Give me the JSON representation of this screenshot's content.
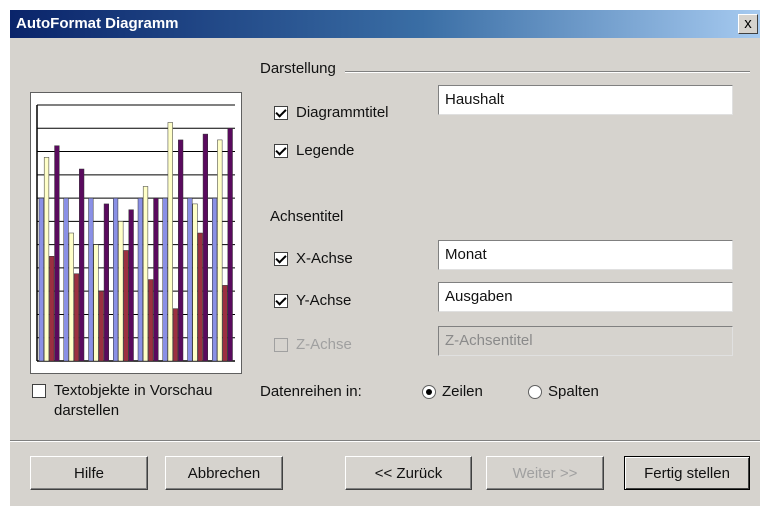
{
  "window": {
    "title": "AutoFormat Diagramm",
    "close_label": "x"
  },
  "darstellung": {
    "label": "Darstellung",
    "diagrammtitel": {
      "label": "Diagrammtitel",
      "checked": true,
      "value": "Haushalt"
    },
    "legende": {
      "label": "Legende",
      "checked": true
    }
  },
  "achsentitel": {
    "label": "Achsentitel",
    "x_achse": {
      "label": "X-Achse",
      "checked": true,
      "value": "Monat"
    },
    "y_achse": {
      "label": "Y-Achse",
      "checked": true,
      "value": "Ausgaben"
    },
    "z_achse": {
      "label": "Z-Achse",
      "checked": false,
      "enabled": false,
      "value": "Z-Achsentitel"
    }
  },
  "preview": {
    "textobjekte_label_line1": "Textobjekte in Vorschau",
    "textobjekte_label_line2": "darstellen",
    "textobjekte_checked": false
  },
  "datenreihen": {
    "label": "Datenreihen in:",
    "options": [
      "Zeilen",
      "Spalten"
    ],
    "selected": "Zeilen"
  },
  "buttons": {
    "hilfe": "Hilfe",
    "abbrechen": "Abbrechen",
    "zurueck": "<< Zurück",
    "weiter": "Weiter >>",
    "fertig": "Fertig stellen"
  },
  "chart_data": {
    "type": "bar",
    "series": [
      {
        "values": [
          14,
          14,
          14,
          14,
          14,
          14,
          14,
          14
        ]
      },
      {
        "values": [
          17.5,
          11,
          10,
          12,
          15,
          20.5,
          13.5,
          19
        ]
      },
      {
        "values": [
          9,
          7.5,
          6,
          9.5,
          7,
          4.5,
          11,
          6.5
        ]
      },
      {
        "values": [
          18.5,
          16.5,
          13.5,
          13,
          14,
          19,
          19.5,
          20
        ]
      }
    ],
    "colors": [
      "#8a90e6",
      "#ffffc8",
      "#9c3040",
      "#5a0a5e"
    ],
    "ylim": [
      0,
      22
    ],
    "grid": true
  }
}
